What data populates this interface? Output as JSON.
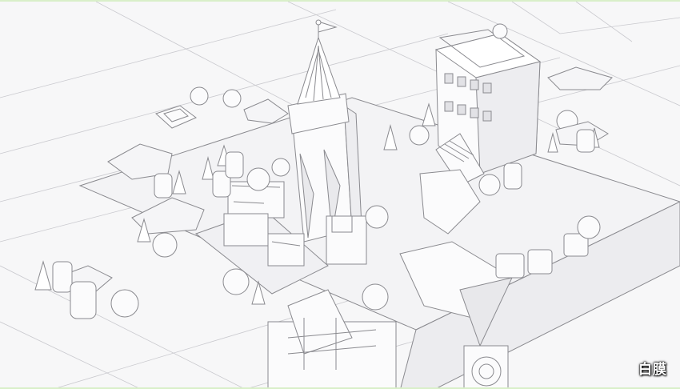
{
  "caption": {
    "badge_text": "白膜"
  },
  "scene": {
    "style": "white-clay wireframe render",
    "colors": {
      "fill": "#fbfbfc",
      "stroke": "#8a8a8f",
      "shadow": "#e6e6ea",
      "frame_accent": "#d9efc9"
    },
    "objects": [
      "castle-tower",
      "flag",
      "townhouse",
      "stone-stairs",
      "cutout-letters",
      "spherical-tree",
      "low-poly-bush",
      "cone-tree",
      "canister",
      "gear-machine",
      "mechanical-arm",
      "grid-floor"
    ]
  }
}
